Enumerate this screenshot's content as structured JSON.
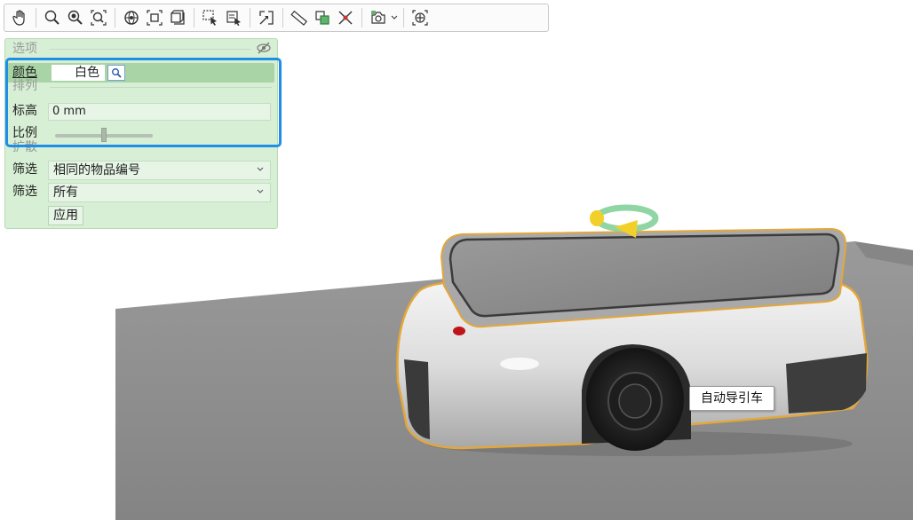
{
  "toolbar": {
    "buttons": [
      {
        "icon": "pan-hand-icon"
      },
      {
        "icon": "zoom-icon"
      },
      {
        "icon": "zoom-plus-icon"
      },
      {
        "icon": "zoom-extents-icon"
      },
      {
        "icon": "globe-view-icon"
      },
      {
        "icon": "fit-selection-icon"
      },
      {
        "icon": "fit-all-icon"
      },
      {
        "icon": "select-box-icon"
      },
      {
        "icon": "select-window-icon"
      },
      {
        "icon": "bounding-box-icon"
      },
      {
        "icon": "measure-ruler-icon"
      },
      {
        "icon": "section-copy-icon"
      },
      {
        "icon": "hide-x-icon"
      },
      {
        "icon": "camera-icon"
      },
      {
        "icon": "center-target-icon"
      }
    ]
  },
  "panel": {
    "options_title": "选项",
    "color_label": "颜色",
    "color_value": "白色",
    "arrange_title": "排列",
    "elevation_label": "标高",
    "elevation_value": "0 mm",
    "scale_label": "比例",
    "scale_fraction": 0.5,
    "expand_title": "扩散",
    "filter1_label": "筛选",
    "filter1_value": "相同的物品编号",
    "filter2_label": "筛选",
    "filter2_value": "所有",
    "apply_label": "应用"
  },
  "scene": {
    "tooltip": "自动导引车",
    "colors": {
      "floor": "#8c8c8c",
      "selection_outline": "#e3a73b",
      "panel_bg": "#d7efd5",
      "highlight": "#1e8fe6"
    }
  }
}
